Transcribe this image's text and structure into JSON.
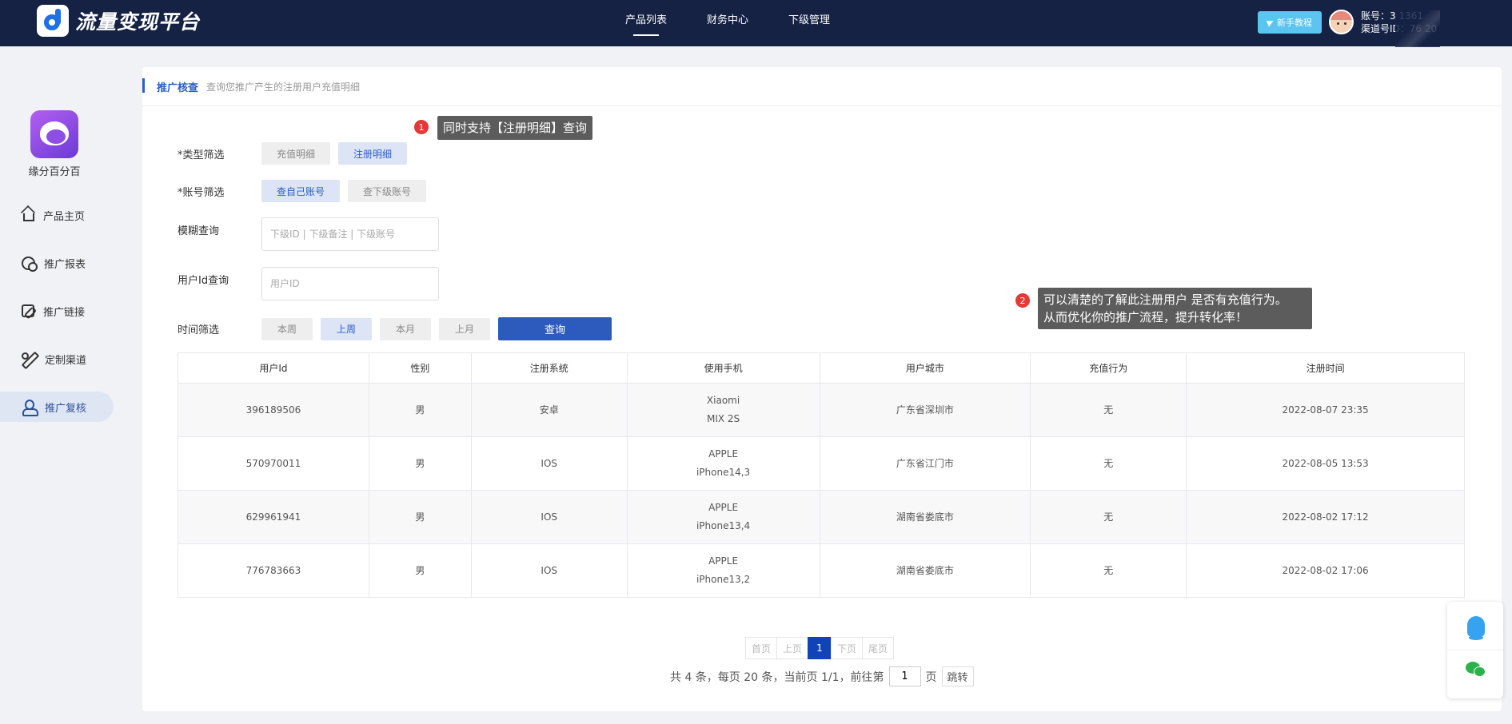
{
  "topbar": {
    "logo_text": "流量变现平台",
    "nav": [
      {
        "label": "产品列表"
      },
      {
        "label": "财务中心"
      },
      {
        "label": "下级管理"
      }
    ],
    "guide_button": "新手教程",
    "account_line": "账号：3        1361",
    "channel_line": "渠道号ID：76   20"
  },
  "sidebar": {
    "app_name": "缘分百分百",
    "items": [
      {
        "label": "产品主页",
        "icon": "home-icon"
      },
      {
        "label": "推广报表",
        "icon": "report-icon"
      },
      {
        "label": "推广链接",
        "icon": "link-icon"
      },
      {
        "label": "定制渠道",
        "icon": "customize-icon"
      },
      {
        "label": "推广复核",
        "icon": "user-check-icon"
      }
    ]
  },
  "card": {
    "title": "推广核查",
    "subtitle": "查询您推广产生的注册用户充值明细"
  },
  "filters": {
    "type_label": "*类型筛选",
    "type_options": [
      "充值明细",
      "注册明细"
    ],
    "account_label": "*账号筛选",
    "account_options": [
      "查自己账号",
      "查下级账号"
    ],
    "fuzzy_label": "模糊查询",
    "fuzzy_placeholder": "下级ID | 下级备注 | 下级账号",
    "userid_label": "用户Id查询",
    "userid_placeholder": "用户ID",
    "time_label": "时间筛选",
    "time_options": [
      "本周",
      "上周",
      "本月",
      "上月"
    ],
    "query_button": "查询"
  },
  "tips": [
    {
      "num": "1",
      "line1": "同时支持【注册明细】查询",
      "line2": ""
    },
    {
      "num": "2",
      "line1": "可以清楚的了解此注册用户 是否有充值行为。",
      "line2": "从而优化你的推广流程，提升转化率！"
    }
  ],
  "table": {
    "headers": [
      "用户Id",
      "性别",
      "注册系统",
      "使用手机",
      "用户城市",
      "充值行为",
      "注册时间"
    ],
    "rows": [
      {
        "id": "396189506",
        "gender": "男",
        "os": "安卓",
        "phone1": "Xiaomi",
        "phone2": "MIX 2S",
        "city": "广东省深圳市",
        "recharge": "无",
        "time": "2022-08-07 23:35"
      },
      {
        "id": "570970011",
        "gender": "男",
        "os": "IOS",
        "phone1": "APPLE",
        "phone2": "iPhone14,3",
        "city": "广东省江门市",
        "recharge": "无",
        "time": "2022-08-05 13:53"
      },
      {
        "id": "629961941",
        "gender": "男",
        "os": "IOS",
        "phone1": "APPLE",
        "phone2": "iPhone13,4",
        "city": "湖南省娄底市",
        "recharge": "无",
        "time": "2022-08-02 17:12"
      },
      {
        "id": "776783663",
        "gender": "男",
        "os": "IOS",
        "phone1": "APPLE",
        "phone2": "iPhone13,2",
        "city": "湖南省娄底市",
        "recharge": "无",
        "time": "2022-08-02 17:06"
      }
    ]
  },
  "pager": {
    "first": "首页",
    "prev": "上页",
    "current": "1",
    "next": "下页",
    "last": "尾页",
    "info": "共 4 条，每页 20 条，当前页 1/1，前往第",
    "jump_value": "1",
    "page_unit": "页",
    "jump_button": "跳转"
  },
  "colors": {
    "topbar": "#152244",
    "accent": "#2b5ec6",
    "query_button": "#2d5bbd",
    "tip_badge": "#e53935"
  }
}
